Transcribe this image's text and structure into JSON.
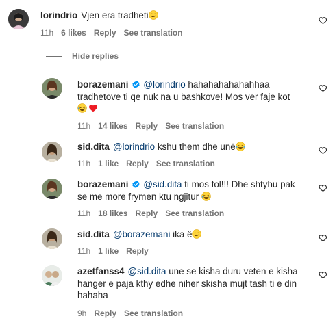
{
  "comments": [
    {
      "username": "lorindrio",
      "text": "Vjen era tradheti",
      "time": "11h",
      "likes": "6 likes",
      "reply": "Reply",
      "translate": "See translation"
    }
  ],
  "hide_replies": "Hide replies",
  "replies": [
    {
      "username": "borazemani",
      "mention": "@lorindrio",
      "text_line1": " hahahahahahahhaa",
      "text_line2": "tradhetove ti qe nuk na u bashkove! Mos ver faje kot",
      "time": "11h",
      "likes": "14 likes",
      "reply": "Reply",
      "translate": "See translation"
    },
    {
      "username": "sid.dita",
      "mention": "@lorindrio",
      "text": " kshu them dhe unë",
      "time": "11h",
      "likes": "1 like",
      "reply": "Reply",
      "translate": "See translation"
    },
    {
      "username": "borazemani",
      "mention": "@sid.dita",
      "text_line1": " ti mos fol!!! Dhe shtyhu pak",
      "text_line2": "se me more frymen ktu ngjitur",
      "time": "11h",
      "likes": "18 likes",
      "reply": "Reply",
      "translate": "See translation"
    },
    {
      "username": "sid.dita",
      "mention": "@borazemani",
      "text": " ika ë",
      "time": "11h",
      "likes": "1 like",
      "reply": "Reply"
    },
    {
      "username": "azetfanss4",
      "mention": "@sid.dita",
      "text_line1": " une se kisha duru veten e kisha",
      "text_line2": "hanger e paja kthy edhe niher skisha mujt tash ti e din",
      "text_line3": "hahaha",
      "time": "9h",
      "reply": "Reply",
      "translate": "See translation"
    }
  ],
  "colors": {
    "text": "#262626",
    "meta": "#737373",
    "mention": "#00376b",
    "verified": "#0095f6",
    "heart_red": "#ed4956"
  },
  "icons": [
    "heart-outline-icon",
    "verified-badge-icon",
    "smirk-emoji-icon",
    "laughing-tears-emoji-icon",
    "red-heart-emoji-icon"
  ]
}
